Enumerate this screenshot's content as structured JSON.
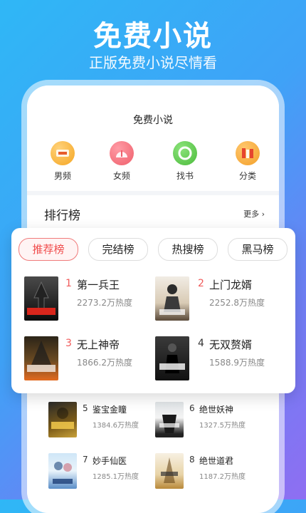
{
  "headline": {
    "title": "免费小说",
    "subtitle": "正版免费小说尽情看"
  },
  "app": {
    "title": "免费小说",
    "categories": [
      {
        "label": "男频",
        "icon": "male-books-icon",
        "color": "#f5a623"
      },
      {
        "label": "女频",
        "icon": "female-books-icon",
        "color": "#ef5f6b"
      },
      {
        "label": "找书",
        "icon": "find-book-icon",
        "color": "#4cbb3c"
      },
      {
        "label": "分类",
        "icon": "category-icon",
        "color": "#f3a02a"
      }
    ],
    "ranking": {
      "title": "排行榜",
      "more": "更多 ›"
    }
  },
  "popup": {
    "tabs": [
      "推荐榜",
      "完结榜",
      "热搜榜",
      "黑马榜"
    ],
    "books": [
      {
        "rank": "1",
        "title": "第一兵王",
        "heat": "2273.2万热度"
      },
      {
        "rank": "2",
        "title": "上门龙婿",
        "heat": "2252.8万热度"
      },
      {
        "rank": "3",
        "title": "无上神帝",
        "heat": "1866.2万热度"
      },
      {
        "rank": "4",
        "title": "无双赘婿",
        "heat": "1588.9万热度"
      }
    ]
  },
  "list": {
    "books": [
      {
        "rank": "5",
        "title": "鉴宝金瞳",
        "heat": "1384.6万热度"
      },
      {
        "rank": "6",
        "title": "绝世妖神",
        "heat": "1327.5万热度"
      },
      {
        "rank": "7",
        "title": "妙手仙医",
        "heat": "1285.1万热度"
      },
      {
        "rank": "8",
        "title": "绝世道君",
        "heat": "1187.2万热度"
      }
    ]
  }
}
